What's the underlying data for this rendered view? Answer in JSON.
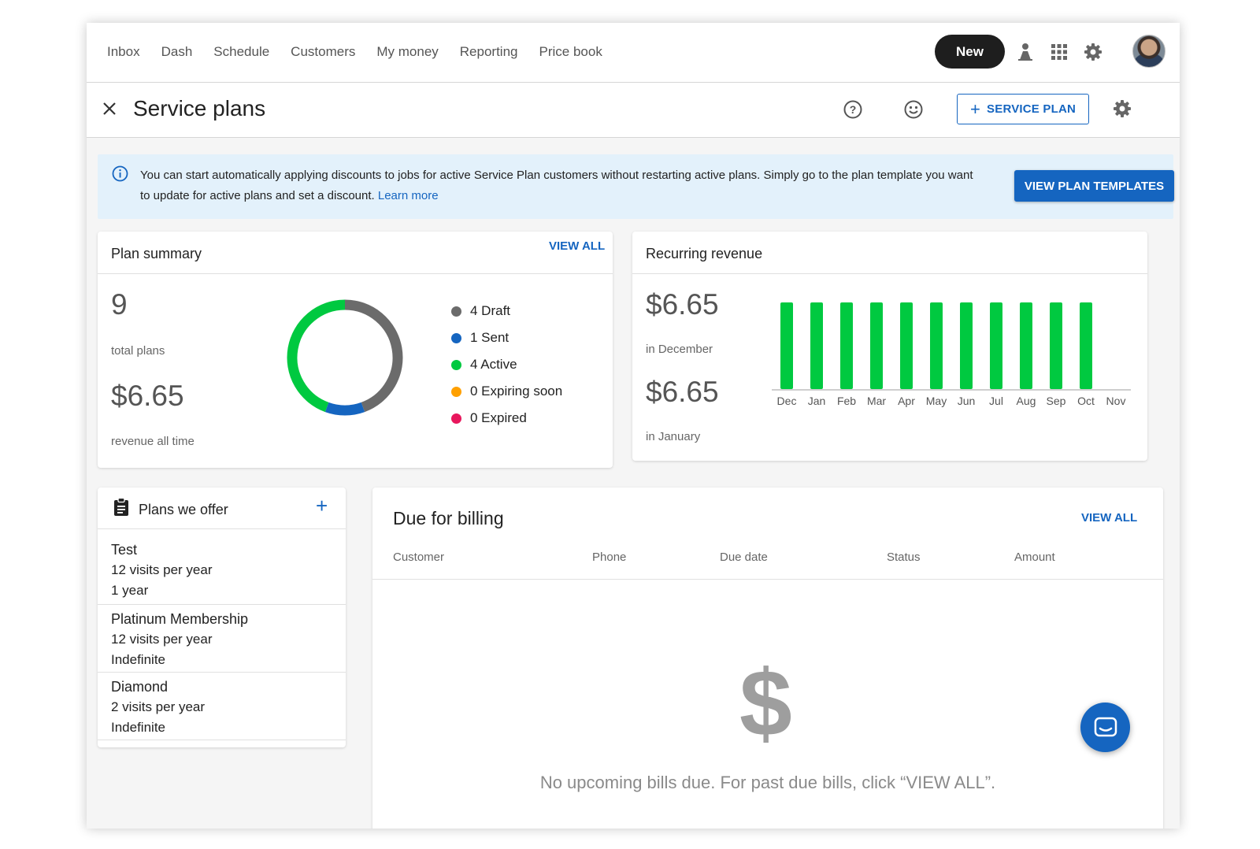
{
  "nav": {
    "links": [
      "Inbox",
      "Dash",
      "Schedule",
      "Customers",
      "My money",
      "Reporting",
      "Price book"
    ],
    "new_label": "New"
  },
  "header": {
    "title": "Service plans",
    "service_plan_label": "SERVICE PLAN"
  },
  "banner": {
    "text": "You can start automatically applying discounts to jobs for active Service Plan customers without restarting active plans. Simply go to the plan template you want to update for active plans and set a discount.",
    "link": "Learn more",
    "button": "VIEW PLAN TEMPLATES"
  },
  "plan_summary": {
    "title": "Plan summary",
    "view_all": "VIEW ALL",
    "total_plans": "9",
    "total_plans_label": "total plans",
    "revenue": "$6.65",
    "revenue_label": "revenue all time",
    "legend": [
      {
        "label": "4 Draft",
        "color": "#6b6b6b",
        "count": 4
      },
      {
        "label": "1 Sent",
        "color": "#1565c0",
        "count": 1
      },
      {
        "label": "4 Active",
        "color": "#00c940",
        "count": 4
      },
      {
        "label": "0 Expiring soon",
        "color": "#ffa000",
        "count": 0
      },
      {
        "label": "0 Expired",
        "color": "#e8175d",
        "count": 0
      }
    ]
  },
  "recurring_revenue": {
    "title": "Recurring revenue",
    "current_amount": "$6.65",
    "current_label": "in December",
    "next_amount": "$6.65",
    "next_label": "in January"
  },
  "chart_data": {
    "type": "bar",
    "categories": [
      "Dec",
      "Jan",
      "Feb",
      "Mar",
      "Apr",
      "May",
      "Jun",
      "Jul",
      "Aug",
      "Sep",
      "Oct",
      "Nov"
    ],
    "values": [
      6.65,
      6.65,
      6.65,
      6.65,
      6.65,
      6.65,
      6.65,
      6.65,
      6.65,
      6.65,
      6.65,
      0
    ],
    "color": "#00c940",
    "ylim": [
      0,
      6.65
    ],
    "grid": false
  },
  "plans_offer": {
    "title": "Plans we offer",
    "items": [
      {
        "name": "Test",
        "visits": "12 visits per year",
        "duration": "1 year"
      },
      {
        "name": "Platinum Membership",
        "visits": "12 visits per year",
        "duration": "Indefinite"
      },
      {
        "name": "Diamond",
        "visits": "2 visits per year",
        "duration": "Indefinite"
      }
    ]
  },
  "billing": {
    "title": "Due for billing",
    "view_all": "VIEW ALL",
    "columns": [
      "Customer",
      "Phone",
      "Due date",
      "Status",
      "Amount"
    ],
    "empty_message": "No upcoming bills due. For past due bills, click “VIEW ALL”.",
    "empty_icon": "dollar-icon"
  },
  "colors": {
    "accent": "#1565c0",
    "active_green": "#00c940",
    "draft_gray": "#6b6b6b"
  }
}
